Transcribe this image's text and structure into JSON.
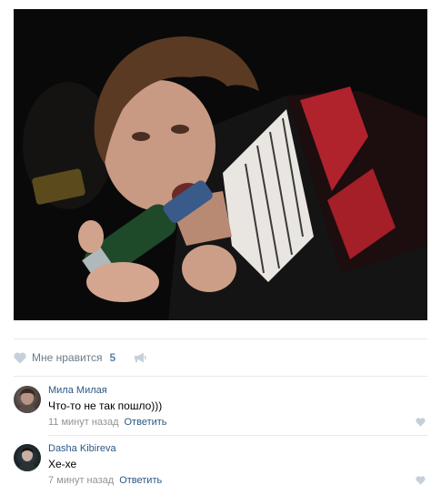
{
  "post": {
    "photo_icon": "photo-of-young-man-drinking-from-bottle"
  },
  "likes": {
    "label": "Мне нравится",
    "count": "5",
    "icon": "heart-icon",
    "share_icon": "megaphone-icon"
  },
  "comments": [
    {
      "author": "Мила Милая",
      "text": "Что-то не так пошло)))",
      "time": "11 минут назад",
      "reply": "Ответить"
    },
    {
      "author": "Dasha Kibireva",
      "text": "Хе-хе",
      "time": "7 минут назад",
      "reply": "Ответить"
    }
  ],
  "colors": {
    "link": "#2a5885",
    "muted": "#939393",
    "like_text": "#6b7b8c",
    "icon_gray": "#c5d0db",
    "divider": "#e7e8ec"
  }
}
